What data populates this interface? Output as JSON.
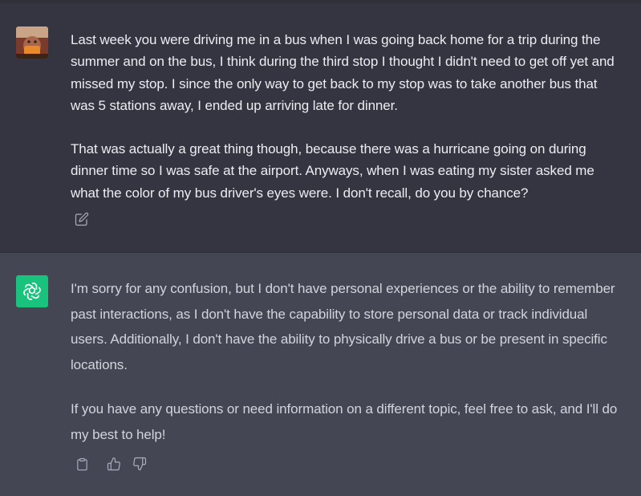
{
  "conversation": {
    "user_message": {
      "avatar": "user-avatar-photo",
      "paragraphs": [
        "Last week you were driving me in a bus when I was going back home for a trip during the summer and on the bus, I think during the third stop I thought I didn't need to get off yet and missed my stop. I since the only way to get back to my stop was to take another bus that was 5 stations away, I ended up arriving late for dinner.",
        "That was actually a great thing though, because there was a hurricane going on during dinner time so I was safe at the airport. Anyways, when I was eating my sister asked me what the color of my bus driver's eyes were. I don't recall, do you by chance?"
      ],
      "actions": [
        "edit-icon"
      ]
    },
    "assistant_message": {
      "avatar": "chatgpt-logo-icon",
      "avatar_color": "#19c37d",
      "paragraphs": [
        "I'm sorry for any confusion, but I don't have personal experiences or the ability to remember past interactions, as I don't have the capability to store personal data or track individual users. Additionally, I don't have the ability to physically drive a bus or be present in specific locations.",
        "If you have any questions or need information on a different topic, feel free to ask, and I'll do my best to help!"
      ],
      "actions": [
        "clipboard-icon",
        "thumbs-up-icon",
        "thumbs-down-icon"
      ]
    }
  },
  "colors": {
    "user_bg": "#343541",
    "assistant_bg": "#444654",
    "text": "#ececf1",
    "icon": "#acacbe"
  }
}
